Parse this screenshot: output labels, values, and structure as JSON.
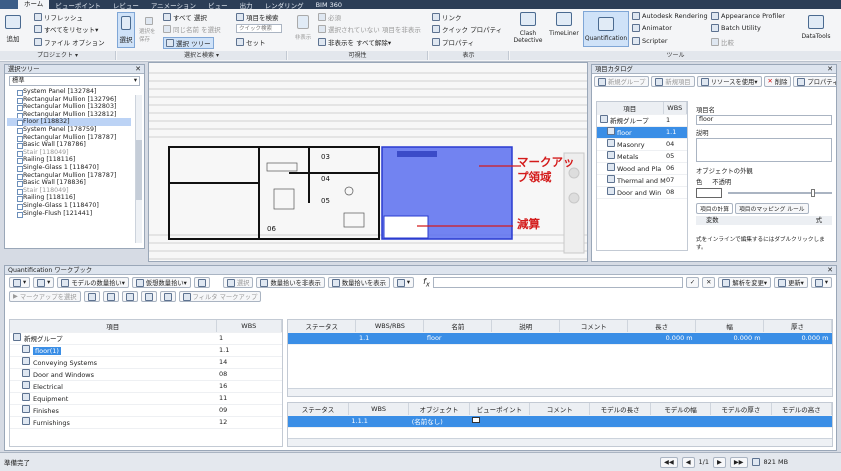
{
  "menubar": {
    "items": [
      "ホーム",
      "ビューポイント",
      "レビュー",
      "アニメーション",
      "ビュー",
      "出力",
      "レンダリング",
      "BIM 360"
    ],
    "active": "ホーム"
  },
  "ribbon": {
    "add_label": "追加",
    "project": {
      "refresh": "リフレッシュ",
      "reset_all": "すべてをリセット▾",
      "file_options": "ファイル オプション",
      "group": "プロジェクト ▾"
    },
    "select": {
      "select": "選択",
      "save_select": "選択を保存",
      "all_select": "すべて 選択",
      "same_select": "同じ名前 を選択",
      "select_tree": "選択 ツリー",
      "find_items": "項目を検索",
      "quick_find_placeholder": "クイック検索",
      "sets": "セット",
      "group": "選択と検索 ▾"
    },
    "visibility": {
      "hide": "非表示",
      "required": "必須",
      "hide_unselected": "選択されていない 項目を非表示",
      "unhide_all": "非表示を すべて解除▾",
      "group": "可視性"
    },
    "display": {
      "links": "リンク",
      "quick_props": "クイック プロパティ",
      "properties": "プロパティ",
      "group": "表示"
    },
    "tools": {
      "clash": "Clash Detective",
      "timeliner": "TimeLiner",
      "quantification": "Quantification",
      "autodesk_rendering": "Autodesk Rendering",
      "animator": "Animator",
      "scripter": "Scripter",
      "appearance_profiler": "Appearance Profiler",
      "batch_utility": "Batch Utility",
      "compare": "比較",
      "datatools": "DataTools",
      "group": "ツール"
    }
  },
  "selection_tree": {
    "title": "選択ツリー",
    "mode": "標準",
    "items": [
      {
        "label": "System Panel [132784]",
        "state": "normal"
      },
      {
        "label": "Rectangular Mullion [132796]",
        "state": "normal"
      },
      {
        "label": "Rectangular Mullion [132803]",
        "state": "normal"
      },
      {
        "label": "Rectangular Mullion [132812]",
        "state": "normal"
      },
      {
        "label": "Floor [118832]",
        "state": "selected"
      },
      {
        "label": "System Panel [178759]",
        "state": "normal"
      },
      {
        "label": "Rectangular Mullion [178787]",
        "state": "normal"
      },
      {
        "label": "Basic Wall [178786]",
        "state": "normal"
      },
      {
        "label": "Stair [118049]",
        "state": "grey"
      },
      {
        "label": "Railing [118116]",
        "state": "normal"
      },
      {
        "label": "Single-Glass 1 [118470]",
        "state": "normal"
      },
      {
        "label": "Rectangular Mullion [178787]",
        "state": "normal"
      },
      {
        "label": "Basic Wall [178836]",
        "state": "normal"
      },
      {
        "label": "Stair [118049]",
        "state": "grey"
      },
      {
        "label": "Railing [118116]",
        "state": "normal"
      },
      {
        "label": "Single-Glass 1 [118470]",
        "state": "normal"
      },
      {
        "label": "Single-Flush [121441]",
        "state": "normal"
      }
    ]
  },
  "viewport": {
    "annotation_markup": "マークアップ領域",
    "annotation_deduct": "減算"
  },
  "catalog": {
    "title": "項目カタログ",
    "toolbar": {
      "new_group": "新規グループ",
      "new_item": "新規項目",
      "use_resource": "リソースを使用▾",
      "delete": "削除",
      "property": "プロパティ"
    },
    "headers": {
      "item": "項目",
      "wbs": "WBS"
    },
    "rows": [
      {
        "label": "新規グループ",
        "wbs": "1"
      },
      {
        "label": "floor",
        "wbs": "1.1"
      },
      {
        "label": "Masonry",
        "wbs": "04"
      },
      {
        "label": "Metals",
        "wbs": "05"
      },
      {
        "label": "Wood and Pla",
        "wbs": "06"
      },
      {
        "label": "Thermal and M",
        "wbs": "07"
      },
      {
        "label": "Door and Win",
        "wbs": "08"
      }
    ],
    "detail": {
      "name_label": "項目名",
      "name_value": "floor",
      "desc_label": "説明",
      "appearance": "オブジェクトの外観",
      "color": "色",
      "opacity": "不透明",
      "tab_calc": "項目の計算",
      "tab_mapping": "項目のマッピング ルール",
      "var_header": "変数",
      "formula_header": "式",
      "hint": "式をインラインで編集するにはダブルクリックします。"
    }
  },
  "workbook": {
    "title": "Quantification ワークブック",
    "toolbar1": {
      "model_takeoff": "モデルの数量拾い▾",
      "virtual_takeoff": "仮想数量拾い▾",
      "select": "選択",
      "hide_takeoff": "数量拾いを非表示",
      "show_takeoff": "数量拾いを表示",
      "filter_markup": "フィルタ マークアップ",
      "change_analysis": "解析を変更▾",
      "update": "更新▾"
    },
    "toolbar2": {
      "select_markup": "マークアップを選択"
    },
    "left_headers": {
      "item": "項目",
      "wbs": "WBS"
    },
    "left_rows": [
      {
        "label": "新規グループ",
        "wbs": "1"
      },
      {
        "label": "floor(1)",
        "wbs": "1.1"
      },
      {
        "label": "Conveying Systems",
        "wbs": "14"
      },
      {
        "label": "Door and Windows",
        "wbs": "08"
      },
      {
        "label": "Electrical",
        "wbs": "16"
      },
      {
        "label": "Equipment",
        "wbs": "11"
      },
      {
        "label": "Finishes",
        "wbs": "09"
      },
      {
        "label": "Furnishings",
        "wbs": "12"
      }
    ],
    "top_headers": [
      "ステータス",
      "WBS/RBS",
      "名前",
      "説明",
      "コメント",
      "長さ",
      "幅",
      "厚さ"
    ],
    "top_row": {
      "wbs": "1.1",
      "name": "floor",
      "length": "0.000 m",
      "width": "0.000 m",
      "thickness": "0.000 m"
    },
    "bottom_headers": [
      "ステータス",
      "WBS",
      "オブジェクト",
      "ビューポイント",
      "コメント",
      "モデルの長さ",
      "モデルの幅",
      "モデルの厚さ",
      "モデルの高さ"
    ],
    "bottom_row": {
      "wbs": "1.1.1",
      "object": "(名前なし)"
    }
  },
  "status": {
    "text": "準備完了",
    "page": "1/1",
    "memory": "821 MB"
  },
  "colors": {
    "markup_fill": "#5b6ff0",
    "selection": "#3a8ee6",
    "annotation": "#d41c1c"
  }
}
